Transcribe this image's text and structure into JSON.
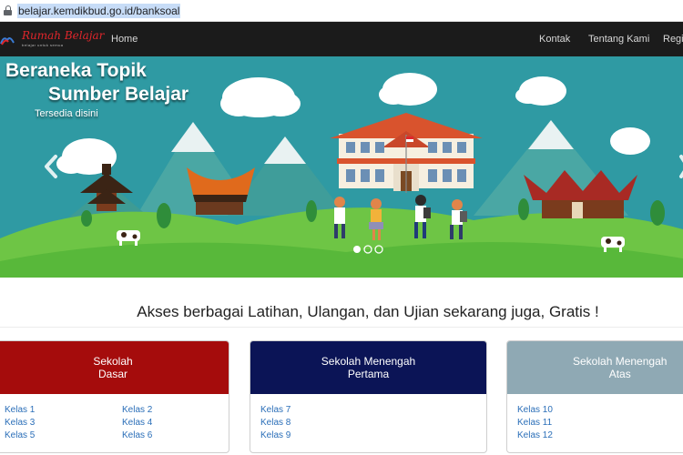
{
  "browser": {
    "url": "belajar.kemdikbud.go.id/banksoal"
  },
  "navbar": {
    "logo_text": "Rumah Belajar",
    "logo_tagline": "belajar untuk semua",
    "home": "Home",
    "contact": "Kontak",
    "about": "Tentang Kami",
    "register": "Regi"
  },
  "hero": {
    "line1": "Beraneka Topik",
    "line2": "Sumber Belajar",
    "line3": "Tersedia disini"
  },
  "headline": "Akses berbagai Latihan, Ulangan, dan Ujian sekarang juga, Gratis !",
  "cards": [
    {
      "title_line1": "Sekolah",
      "title_line2": "Dasar",
      "color": "#a50c0c",
      "left": [
        "Kelas 1",
        "Kelas 3",
        "Kelas 5"
      ],
      "right": [
        "Kelas 2",
        "Kelas 4",
        "Kelas 6"
      ]
    },
    {
      "title_line1": "Sekolah Menengah",
      "title_line2": "Pertama",
      "color": "#0b1456",
      "left": [
        "Kelas 7",
        "Kelas 8",
        "Kelas 9"
      ],
      "right": []
    },
    {
      "title_line1": "Sekolah Menengah",
      "title_line2": "Atas",
      "color": "#8fa9b4",
      "left": [
        "Kelas 10",
        "Kelas 11",
        "Kelas 12"
      ],
      "right": []
    }
  ],
  "colors": {
    "navbar_bg": "#1b1b1b",
    "link": "#2a6eb8",
    "sky": "#2f9aa3",
    "grass": "#58b83a"
  },
  "icons": {
    "lock": "lock-icon",
    "prev": "chevron-left-icon",
    "next": "chevron-right-icon"
  }
}
